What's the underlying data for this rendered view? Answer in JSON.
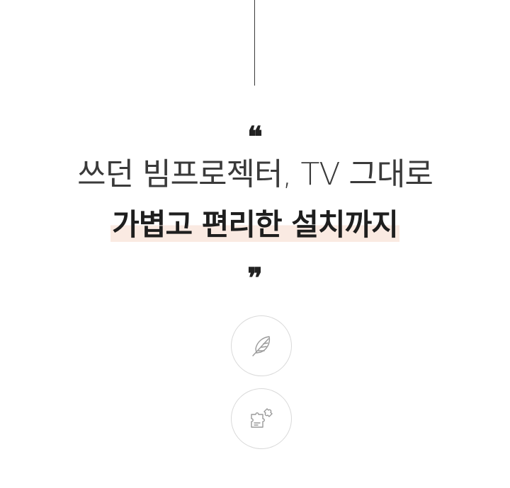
{
  "quote_open": "❝",
  "quote_close": "❞",
  "headline": {
    "line1": "쓰던 빔프로젝터, TV 그대로",
    "line2": "가볍고 편리한 설치까지"
  },
  "icons": [
    {
      "name": "feather-icon"
    },
    {
      "name": "puzzle-icon"
    }
  ],
  "colors": {
    "text": "#333333",
    "highlight": "#faeae2",
    "icon_stroke": "#9a9a9a"
  }
}
